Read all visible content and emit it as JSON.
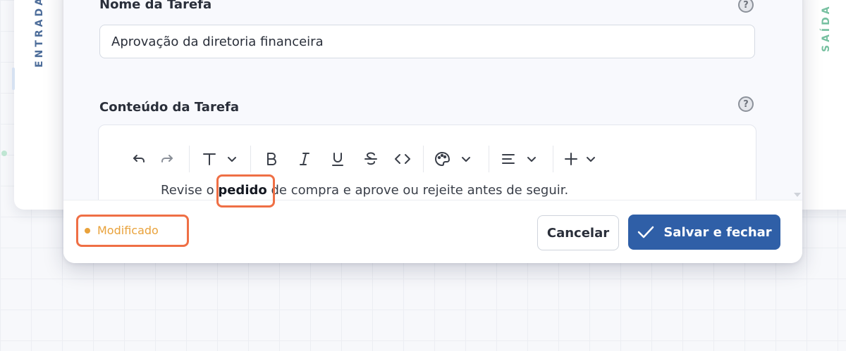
{
  "background": {
    "left_panel_label": "ENTRADA",
    "right_panel_label": "SAÍDA"
  },
  "modal": {
    "task_name": {
      "label": "Nome da Tarefa",
      "value": "Aprovação da diretoria financeira",
      "help_icon": "question-circle-icon"
    },
    "task_content": {
      "label": "Conteúdo da Tarefa",
      "help_icon": "question-circle-icon",
      "toolbar": [
        {
          "name": "undo-icon"
        },
        {
          "name": "redo-icon"
        },
        {
          "name": "text-style-icon"
        },
        {
          "name": "bold-icon"
        },
        {
          "name": "italic-icon"
        },
        {
          "name": "underline-icon"
        },
        {
          "name": "strikethrough-icon"
        },
        {
          "name": "code-icon"
        },
        {
          "name": "palette-icon"
        },
        {
          "name": "align-icon"
        },
        {
          "name": "plus-icon"
        }
      ],
      "text_before": "Revise o ",
      "text_bold": "pedido",
      "text_after": " de compra e aprove ou rejeite antes de seguir."
    },
    "footer": {
      "status": "Modificado",
      "cancel_label": "Cancelar",
      "save_label": "Salvar e fechar"
    }
  },
  "colors": {
    "accent": "#2f5fa7",
    "status": "#e9a23b",
    "highlight": "#ef6f45"
  }
}
